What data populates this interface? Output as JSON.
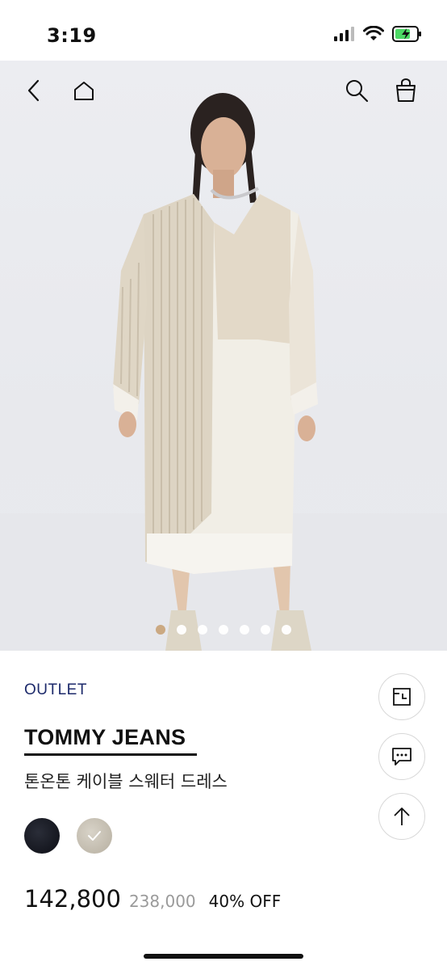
{
  "status_bar": {
    "time": "3:19",
    "icons": [
      "signal-icon",
      "wifi-icon",
      "battery-charging-icon"
    ]
  },
  "nav": {
    "left_icons": [
      "back-arrow-icon",
      "home-icon"
    ],
    "right_icons": [
      "search-icon",
      "shopping-bag-icon"
    ]
  },
  "carousel": {
    "total_images": 7,
    "active_index": 0
  },
  "product": {
    "label": "OUTLET",
    "brand": "TOMMY JEANS",
    "name": "톤온톤 케이블 스웨터 드레스",
    "price": "142,800",
    "original_price": "238,000",
    "discount": "40% OFF",
    "colors": [
      {
        "name": "navy",
        "hex": "#15171f",
        "selected": false
      },
      {
        "name": "beige",
        "hex": "#c8c2b5",
        "selected": true
      }
    ]
  },
  "side_actions": [
    "recent-view-icon",
    "chat-icon",
    "scroll-top-icon"
  ],
  "colors": {
    "outlet_text": "#1d2a6b",
    "carousel_active": "#c9a57c"
  }
}
